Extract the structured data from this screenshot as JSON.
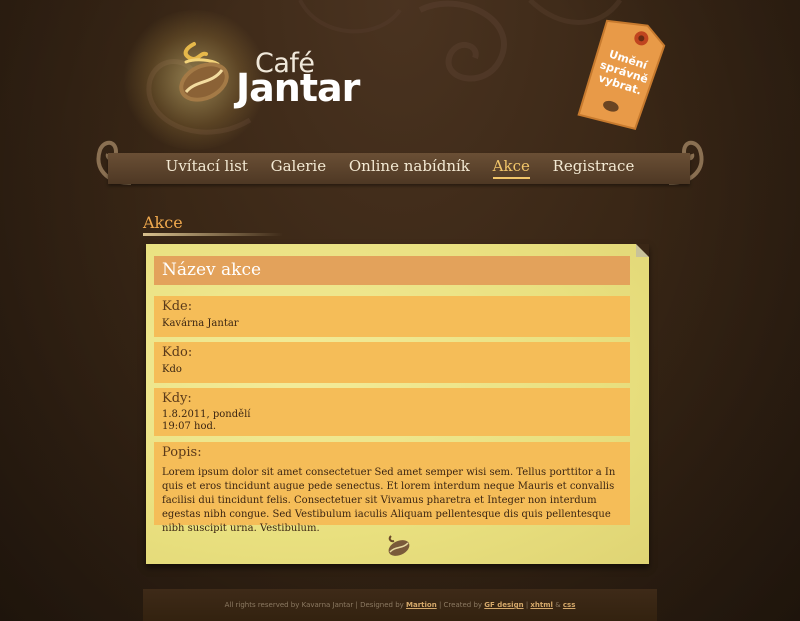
{
  "brand": {
    "cafe": "Café",
    "name": "Jantar"
  },
  "tag": {
    "line1": "Umění",
    "line2": "správně",
    "line3": "vybrat."
  },
  "nav": {
    "items": [
      {
        "label": "Uvítací list"
      },
      {
        "label": "Galerie"
      },
      {
        "label": "Online nabídník"
      },
      {
        "label": "Akce",
        "active": true
      },
      {
        "label": "Registrace"
      }
    ]
  },
  "page": {
    "heading": "Akce"
  },
  "event": {
    "title": "Název akce",
    "where": {
      "label": "Kde:",
      "value": "Kavárna Jantar"
    },
    "who": {
      "label": "Kdo:",
      "value": "Kdo"
    },
    "when": {
      "label": "Kdy:",
      "date": "1.8.2011, pondělí",
      "time": "19:07 hod."
    },
    "description": {
      "label": "Popis:",
      "text": "Lorem ipsum dolor sit amet consectetuer Sed amet semper wisi sem. Tellus porttitor a In quis et eros tincidunt augue pede senectus. Et lorem interdum neque Mauris et convallis facilisi dui tincidunt felis. Consectetuer sit Vivamus pharetra et Integer non interdum egestas nibh congue. Sed Vestibulum iaculis Aliquam pellentesque dis quis pellentesque nibh suscipit urna. Vestibulum."
    }
  },
  "footer": {
    "rights": "All rights reserved by Kavarna Jantar",
    "designed_by_label": "Designed by",
    "designer": "Martion",
    "created_by_label": "Created by",
    "creator": "GF design",
    "xhtml": "xhtml",
    "amp": "&",
    "css": "css",
    "sep": "|"
  },
  "colors": {
    "background": "#3a2716",
    "accent": "#f0a94e",
    "nav_active": "#f2c66a",
    "paper": "#ece27f",
    "block": "#f5bd58",
    "title_bar": "#e3a25b"
  },
  "icons": [
    "coffee-bean-logo-icon",
    "price-tag-icon",
    "coffee-bean-icon"
  ]
}
